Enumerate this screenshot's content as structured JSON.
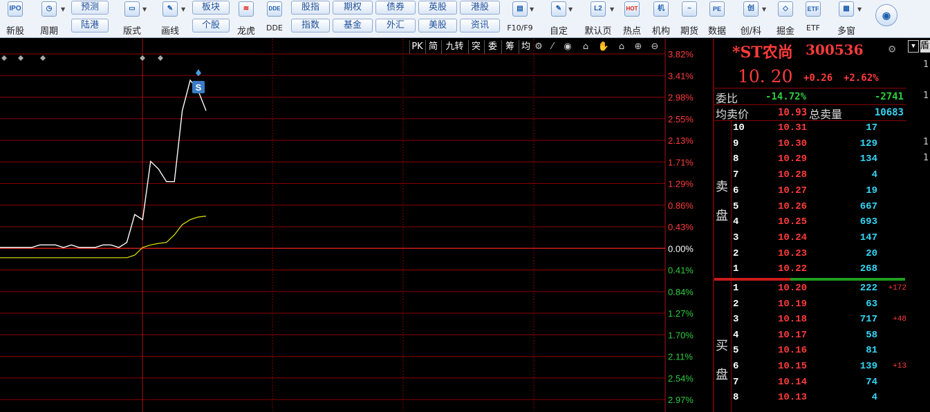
{
  "toolbar": {
    "tools": [
      {
        "id": "new-stock",
        "label": "新股",
        "icon": "IPO"
      },
      {
        "id": "period",
        "label": "周期",
        "icon": "◷"
      },
      {
        "id": "layout",
        "label": "版式",
        "icon": "▭"
      },
      {
        "id": "draw",
        "label": "画线",
        "icon": "✎"
      },
      {
        "id": "dragon-tiger",
        "label": "龙虎",
        "icon": "≋"
      },
      {
        "id": "dde",
        "label": "DDE",
        "icon": "DDE"
      },
      {
        "id": "f10",
        "label": "F10/F9",
        "icon": "▤"
      },
      {
        "id": "custom",
        "label": "自定",
        "icon": "✎"
      },
      {
        "id": "default-page",
        "label": "默认页",
        "icon": "L2"
      },
      {
        "id": "hotspot",
        "label": "热点",
        "icon": "HOT"
      },
      {
        "id": "institution",
        "label": "机构",
        "icon": "机"
      },
      {
        "id": "futures",
        "label": "期货",
        "icon": "~"
      },
      {
        "id": "data",
        "label": "数据",
        "icon": "PE"
      },
      {
        "id": "chuangke",
        "label": "创/科",
        "icon": "创"
      },
      {
        "id": "juejin",
        "label": "掘金",
        "icon": "◇"
      },
      {
        "id": "etf",
        "label": "ETF",
        "icon": "ETF"
      },
      {
        "id": "multi-window",
        "label": "多窗",
        "icon": "▦"
      }
    ],
    "pills_top": [
      "预测",
      "板块",
      "股指",
      "期权",
      "债券",
      "英股",
      "港股"
    ],
    "pills_bottom": [
      "陆港",
      "个股",
      "指数",
      "基金",
      "外汇",
      "美股",
      "资讯"
    ]
  },
  "chart": {
    "tabs": [
      "PK",
      "简",
      "九转",
      "突",
      "委",
      "筹",
      "均"
    ],
    "signal_marker": "S",
    "right_axis": [
      "3.82%",
      "3.41%",
      "2.98%",
      "2.55%",
      "2.13%",
      "1.71%",
      "1.29%",
      "0.86%",
      "0.43%",
      "0.00%",
      "0.41%",
      "0.84%",
      "1.27%",
      "1.70%",
      "2.11%",
      "2.54%",
      "2.97%"
    ],
    "colors": {
      "grid": "#8b0000",
      "up": "#ff3b3b",
      "down": "#2ecc40",
      "price": "#ffffff",
      "avg": "#e6e600"
    }
  },
  "chart_data": {
    "type": "line",
    "series": [
      {
        "values": [
          0,
          0,
          0,
          0,
          0,
          0.05,
          0.05,
          0.05,
          0,
          0.05,
          0,
          0,
          0,
          0.05,
          0.05,
          0,
          0.1,
          0.65,
          0.55,
          1.7,
          1.55,
          1.3,
          1.3,
          2.7,
          3.3,
          3.1,
          2.7
        ]
      },
      {
        "values": [
          -0.2,
          -0.2,
          -0.2,
          -0.2,
          -0.2,
          -0.2,
          -0.2,
          -0.2,
          -0.2,
          -0.2,
          -0.2,
          -0.2,
          -0.2,
          -0.2,
          -0.2,
          -0.2,
          -0.2,
          -0.15,
          0,
          0.05,
          0.08,
          0.1,
          0.25,
          0.45,
          0.55,
          0.6,
          0.62
        ]
      }
    ],
    "ylim": [
      -2.97,
      3.82
    ]
  },
  "quote": {
    "name": "*ST农尚",
    "code": "300536",
    "price": "10. 20",
    "change": "+0.26",
    "change_pct": "+2.62%",
    "weibi_label": "委比",
    "weibi_pct": "-14.72%",
    "weibi_diff": "-2741",
    "avg_label": "均卖价",
    "avg_value": "10.93",
    "total_label": "总卖量",
    "total_value": "10683",
    "sell_label_1": "卖",
    "sell_label_2": "盘",
    "buy_label_1": "买",
    "buy_label_2": "盘",
    "sell": [
      {
        "lvl": "10",
        "price": "10.31",
        "qty": "17"
      },
      {
        "lvl": "9",
        "price": "10.30",
        "qty": "129"
      },
      {
        "lvl": "8",
        "price": "10.29",
        "qty": "134"
      },
      {
        "lvl": "7",
        "price": "10.28",
        "qty": "4"
      },
      {
        "lvl": "6",
        "price": "10.27",
        "qty": "19"
      },
      {
        "lvl": "5",
        "price": "10.26",
        "qty": "667"
      },
      {
        "lvl": "4",
        "price": "10.25",
        "qty": "693"
      },
      {
        "lvl": "3",
        "price": "10.24",
        "qty": "147"
      },
      {
        "lvl": "2",
        "price": "10.23",
        "qty": "20"
      },
      {
        "lvl": "1",
        "price": "10.22",
        "qty": "268"
      }
    ],
    "buy": [
      {
        "lvl": "1",
        "price": "10.20",
        "qty": "222",
        "chg": "+172"
      },
      {
        "lvl": "2",
        "price": "10.19",
        "qty": "63",
        "chg": ""
      },
      {
        "lvl": "3",
        "price": "10.18",
        "qty": "717",
        "chg": "+48"
      },
      {
        "lvl": "4",
        "price": "10.17",
        "qty": "58",
        "chg": ""
      },
      {
        "lvl": "5",
        "price": "10.16",
        "qty": "81",
        "chg": ""
      },
      {
        "lvl": "6",
        "price": "10.15",
        "qty": "139",
        "chg": "+13"
      },
      {
        "lvl": "7",
        "price": "10.14",
        "qty": "74",
        "chg": ""
      },
      {
        "lvl": "8",
        "price": "10.13",
        "qty": "4",
        "chg": ""
      }
    ]
  },
  "right_strip": [
    "1",
    "1",
    "1",
    "1"
  ]
}
